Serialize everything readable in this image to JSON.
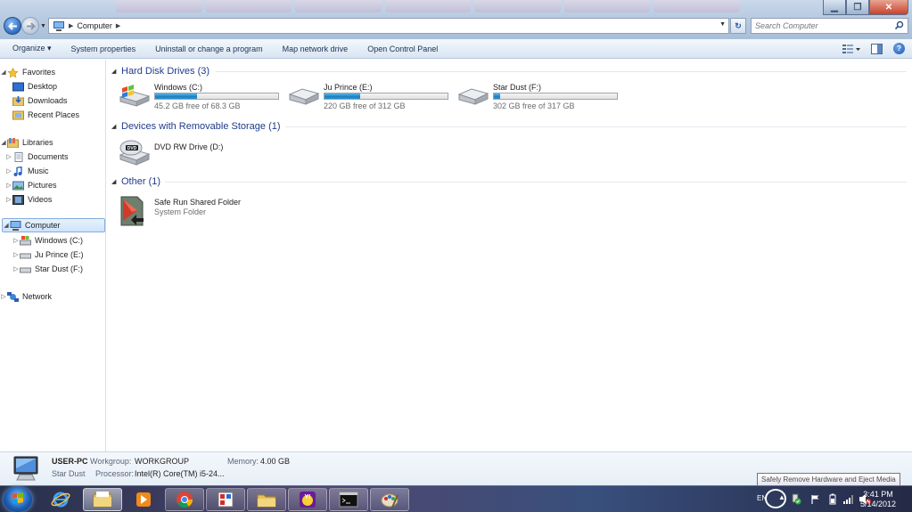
{
  "window": {
    "breadcrumb": [
      "Computer"
    ],
    "search_placeholder": "Search Computer"
  },
  "toolbar": {
    "items": [
      "Organize ▾",
      "System properties",
      "Uninstall or change a program",
      "Map network drive",
      "Open Control Panel"
    ]
  },
  "nav": {
    "favorites": {
      "label": "Favorites",
      "items": [
        "Desktop",
        "Downloads",
        "Recent Places"
      ]
    },
    "libraries": {
      "label": "Libraries",
      "items": [
        "Documents",
        "Music",
        "Pictures",
        "Videos"
      ]
    },
    "computer": {
      "label": "Computer",
      "items": [
        "Windows (C:)",
        "Ju Prince (E:)",
        "Star Dust (F:)"
      ]
    },
    "network": {
      "label": "Network"
    }
  },
  "groups": {
    "hard_disks": {
      "title": "Hard Disk Drives (3)",
      "drives": [
        {
          "name": "Windows (C:)",
          "free": "45.2 GB free of 68.3 GB",
          "used_fraction": 0.34
        },
        {
          "name": "Ju Prince (E:)",
          "free": "220 GB free of 312 GB",
          "used_fraction": 0.29
        },
        {
          "name": "Star Dust (F:)",
          "free": "302 GB free of 317 GB",
          "used_fraction": 0.05
        }
      ]
    },
    "removable": {
      "title": "Devices with Removable Storage (1)",
      "items": [
        {
          "name": "DVD RW Drive (D:)"
        }
      ]
    },
    "other": {
      "title": "Other (1)",
      "items": [
        {
          "name": "Safe Run Shared Folder",
          "subtitle": "System Folder"
        }
      ]
    }
  },
  "details": {
    "computer_name": "USER-PC",
    "workgroup_label": "Workgroup:",
    "workgroup": "WORKGROUP",
    "memory_label": "Memory:",
    "memory": "4.00 GB",
    "subtitle": "Star Dust",
    "processor_label": "Processor:",
    "processor": "Intel(R) Core(TM) i5-24..."
  },
  "taskbar": {
    "apps": [
      "internet-explorer",
      "windows-explorer",
      "media-player",
      "chrome",
      "paint-app",
      "folder",
      "yahoo-messenger",
      "command-prompt",
      "paint-brush"
    ],
    "language": "EN",
    "time": "3:41 PM",
    "date": "5/14/2012",
    "tooltip": "Safely Remove Hardware and Eject Media"
  },
  "colors": {
    "group_title": "#1e3c8c",
    "bar_fill": "#2a97d3",
    "selection": "#cde4fb"
  }
}
